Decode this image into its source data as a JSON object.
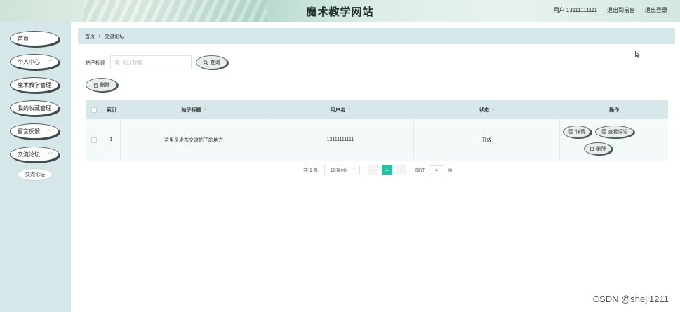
{
  "header": {
    "site_title": "魔术教学网站",
    "user_label": "用户 13111111111",
    "back_front": "退出到前台",
    "logout": "退出登录"
  },
  "sidebar": {
    "items": [
      {
        "label": "首页",
        "has_arrow": false
      },
      {
        "label": "个人中心",
        "has_arrow": true
      },
      {
        "label": "魔术教学管理",
        "has_arrow": false
      },
      {
        "label": "我的收藏管理",
        "has_arrow": false
      },
      {
        "label": "留言反馈",
        "has_arrow": true
      },
      {
        "label": "交流论坛",
        "has_arrow": true
      }
    ],
    "sub_items": [
      {
        "label": "交流论坛"
      }
    ]
  },
  "breadcrumb": {
    "home": "首页",
    "separator": "/",
    "current": "交流论坛"
  },
  "search": {
    "label": "帖子标题",
    "placeholder": "帖子标题",
    "query_button": "查询"
  },
  "actions": {
    "delete_button": "删除"
  },
  "table": {
    "headers": {
      "index": "索引",
      "title": "帖子标题",
      "username": "用户名",
      "status": "状态",
      "operations": "操作"
    },
    "rows": [
      {
        "index": "1",
        "title": "这里是发布交流帖子的地方",
        "username": "13111111111",
        "status": "开放",
        "ops": {
          "detail": "详情",
          "comments": "查看评论",
          "delete": "删除"
        }
      }
    ]
  },
  "pagination": {
    "total": "共 1 条",
    "page_size": "10条/页",
    "current_page": "1",
    "goto_label": "前往",
    "goto_value": "1",
    "page_suffix": "页"
  },
  "watermark": "CSDN @sheji1211",
  "colors": {
    "accent": "#27c0a3",
    "sidebar_bg": "#d5e7e8",
    "table_header_bg": "#d7e8ea"
  }
}
